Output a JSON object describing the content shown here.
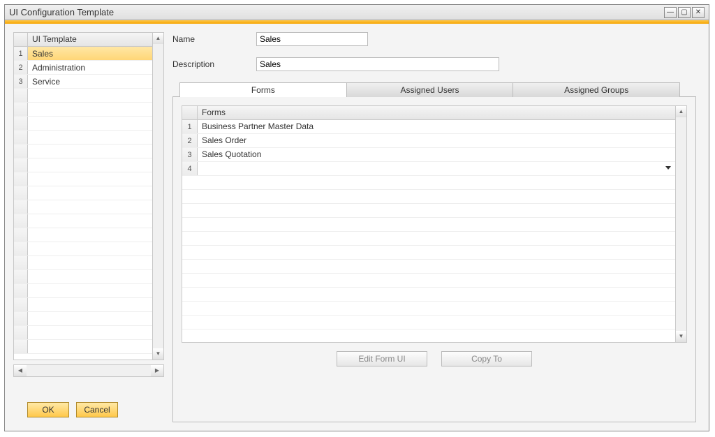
{
  "window": {
    "title": "UI Configuration Template"
  },
  "left_panel": {
    "header": "UI Template",
    "items": [
      {
        "num": "1",
        "label": "Sales",
        "selected": true
      },
      {
        "num": "2",
        "label": "Administration",
        "selected": false
      },
      {
        "num": "3",
        "label": "Service",
        "selected": false
      }
    ]
  },
  "fields": {
    "name_label": "Name",
    "name_value": "Sales",
    "desc_label": "Description",
    "desc_value": "Sales"
  },
  "tabs": {
    "forms": "Forms",
    "assigned_users": "Assigned Users",
    "assigned_groups": "Assigned Groups"
  },
  "grid": {
    "header": "Forms",
    "rows": [
      {
        "num": "1",
        "label": "Business Partner Master Data"
      },
      {
        "num": "2",
        "label": "Sales Order"
      },
      {
        "num": "3",
        "label": "Sales Quotation"
      },
      {
        "num": "4",
        "label": "",
        "dropdown": true
      }
    ]
  },
  "buttons": {
    "edit_form_ui": "Edit Form UI",
    "copy_to": "Copy To",
    "ok": "OK",
    "cancel": "Cancel"
  }
}
